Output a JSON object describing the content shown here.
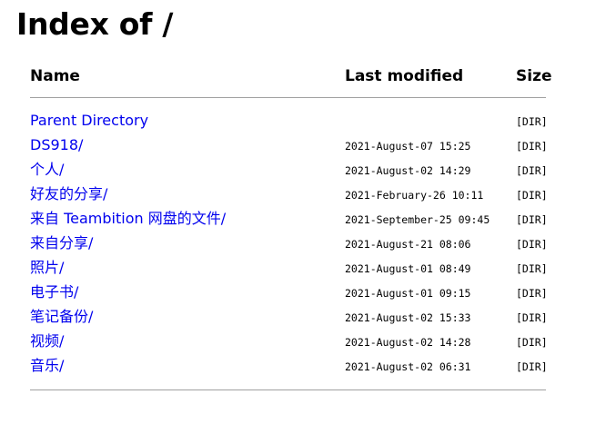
{
  "page": {
    "title": "Index of /"
  },
  "table": {
    "headers": {
      "name": "Name",
      "last_modified": "Last modified",
      "size": "Size"
    },
    "rows": [
      {
        "name": "Parent Directory",
        "modified": "",
        "size": "[DIR]"
      },
      {
        "name": "DS918/",
        "modified": "2021-August-07 15:25",
        "size": "[DIR]"
      },
      {
        "name": "个人/",
        "modified": "2021-August-02 14:29",
        "size": "[DIR]"
      },
      {
        "name": "好友的分享/",
        "modified": "2021-February-26 10:11",
        "size": "[DIR]"
      },
      {
        "name": "来自 Teambition 网盘的文件/",
        "modified": "2021-September-25 09:45",
        "size": "[DIR]"
      },
      {
        "name": "来自分享/",
        "modified": "2021-August-21 08:06",
        "size": "[DIR]"
      },
      {
        "name": "照片/",
        "modified": "2021-August-01 08:49",
        "size": "[DIR]"
      },
      {
        "name": "电子书/",
        "modified": "2021-August-01 09:15",
        "size": "[DIR]"
      },
      {
        "name": "笔记备份/",
        "modified": "2021-August-02 15:33",
        "size": "[DIR]"
      },
      {
        "name": "视频/",
        "modified": "2021-August-02 14:28",
        "size": "[DIR]"
      },
      {
        "name": "音乐/",
        "modified": "2021-August-02 06:31",
        "size": "[DIR]"
      }
    ]
  },
  "colors": {
    "link": "#0000ee",
    "text": "#000000",
    "rule": "#a0a0a0"
  }
}
